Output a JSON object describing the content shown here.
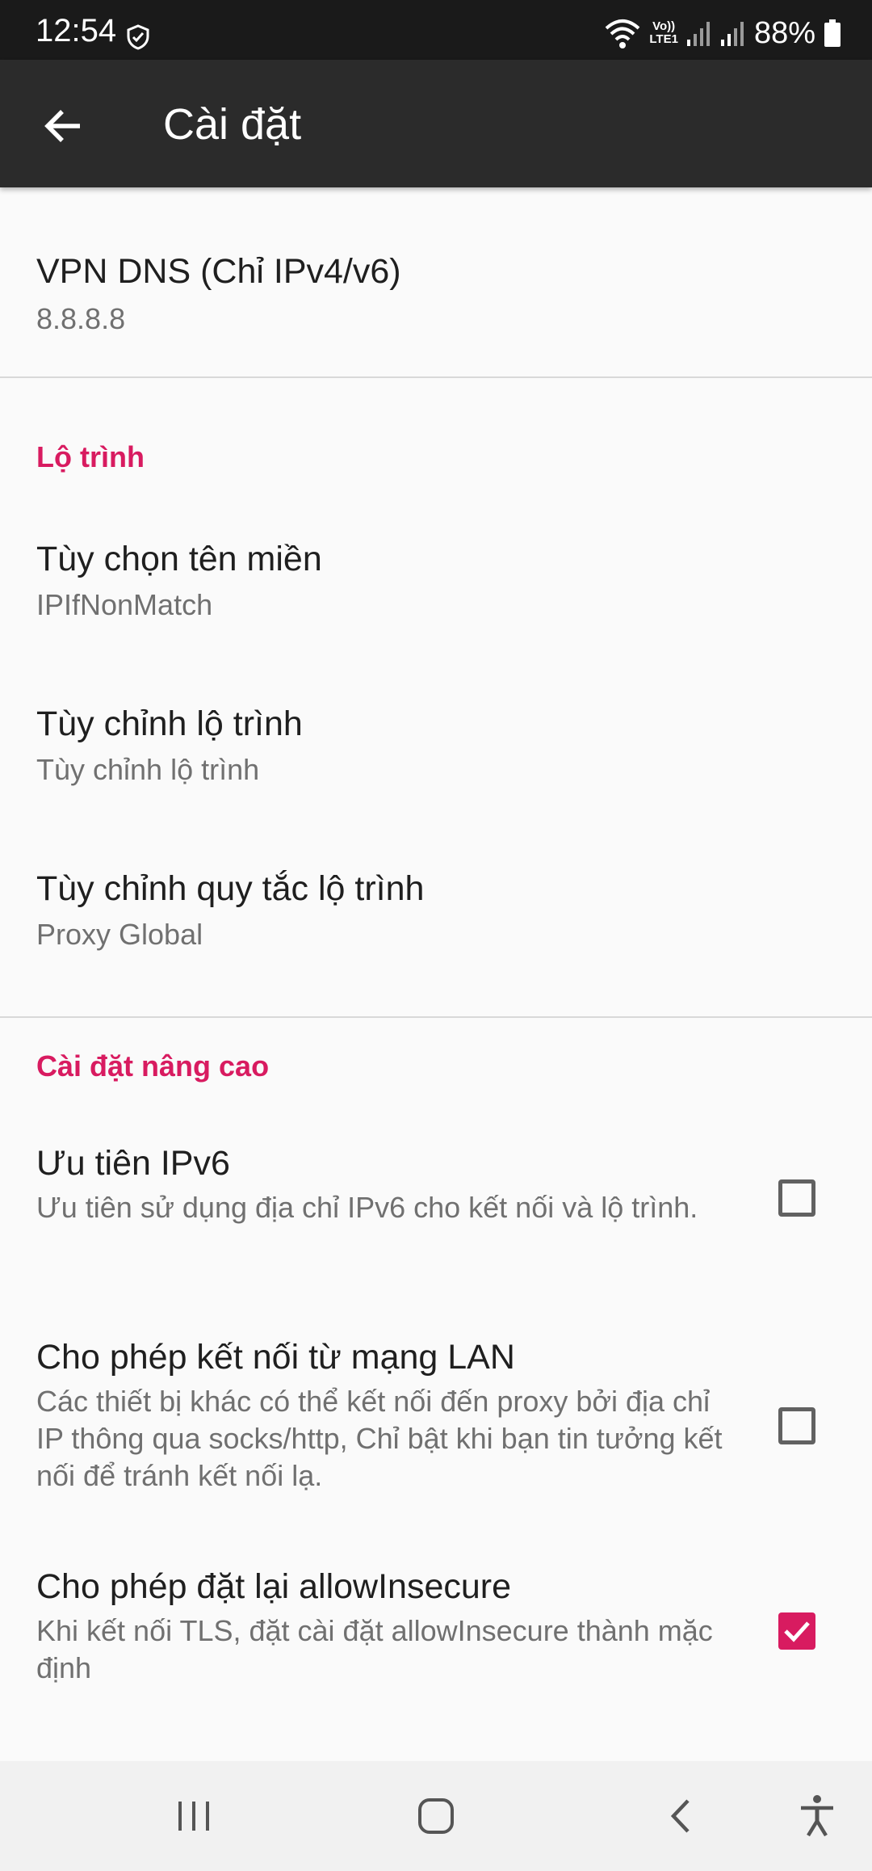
{
  "status_bar": {
    "time": "12:54",
    "battery_text": "88%",
    "icons": [
      "shield-icon",
      "wifi-icon",
      "volte-icon",
      "signal-icon",
      "signal-icon",
      "battery-icon"
    ],
    "volte_line1": "Vo))",
    "volte_line2": "LTE1"
  },
  "app_bar": {
    "title": "Cài đặt",
    "back_icon": "arrow-back-icon"
  },
  "settings": {
    "vpn_dns": {
      "title": "VPN DNS (Chỉ IPv4/v6)",
      "summary": "8.8.8.8"
    },
    "routing_category": "Lộ trình",
    "domain_strategy": {
      "title": "Tùy chọn tên miền",
      "summary": "IPIfNonMatch"
    },
    "custom_routing": {
      "title": "Tùy chỉnh lộ trình",
      "summary": "Tùy chỉnh lộ trình"
    },
    "custom_routing_rules": {
      "title": "Tùy chỉnh quy tắc lộ trình",
      "summary": "Proxy Global"
    },
    "advanced_category": "Cài đặt nâng cao",
    "prefer_ipv6": {
      "title": "Ưu tiên IPv6",
      "summary": "Ưu tiên sử dụng địa chỉ IPv6 cho kết nối và lộ trình.",
      "checked": false
    },
    "allow_lan": {
      "title": "Cho phép kết nối từ mạng LAN",
      "summary": "Các thiết bị khác có thể kết nối đến proxy bởi địa chỉ IP thông qua socks/http, Chỉ bật khi bạn tin tưởng kết nối để tránh kết nối lạ.",
      "checked": false
    },
    "allow_insecure": {
      "title": "Cho phép đặt lại allowInsecure",
      "summary": "Khi kết nối TLS, đặt cài đặt allowInsecure thành mặc định",
      "checked": true
    }
  },
  "nav_bar": {
    "icons": [
      "recents-icon",
      "home-icon",
      "back-icon",
      "accessibility-icon"
    ]
  },
  "colors": {
    "accent": "#d81b60",
    "app_bar": "#2b2b2b",
    "status_bar": "#1a1a1a",
    "background": "#fafafa"
  }
}
